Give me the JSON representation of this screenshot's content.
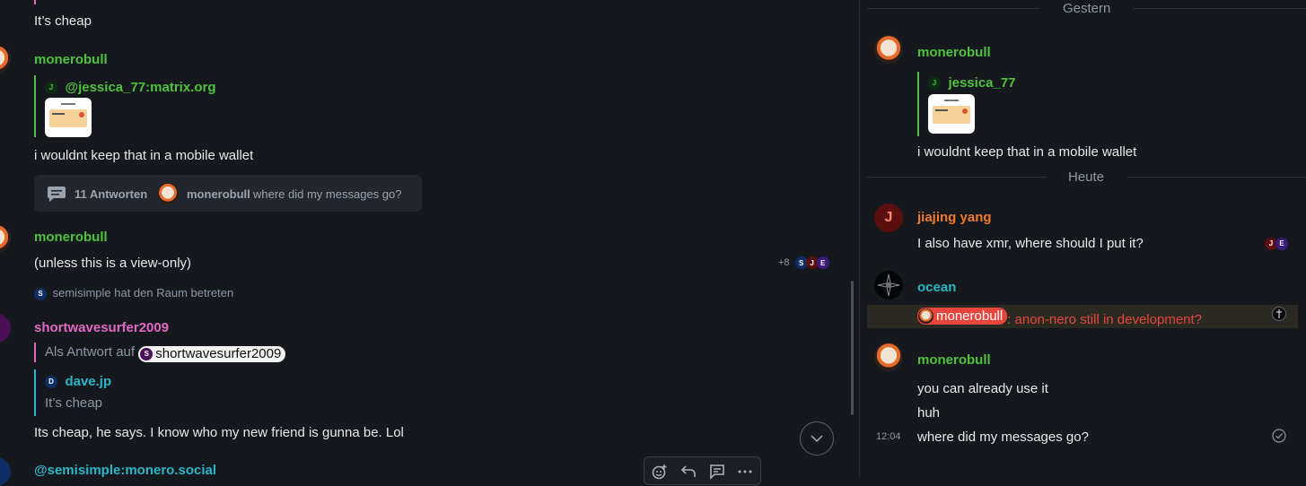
{
  "left": {
    "top_text": "It’s cheap",
    "msg1": {
      "author": "monerobull",
      "reply_user": "@jessica_77:matrix.org",
      "reply_initial": "J",
      "body": "i wouldnt keep that in a mobile wallet"
    },
    "thread": {
      "count": "11 Antworten",
      "author": "monerobull",
      "preview": "where did my messages go?"
    },
    "msg2": {
      "author": "monerobull",
      "body": "(unless this is a view-only)",
      "read_more": "+8",
      "read_initials": [
        "S",
        "J",
        "E"
      ]
    },
    "join_event": {
      "initial": "S",
      "text": "semisimple hat den Raum betreten"
    },
    "msg3": {
      "author": "shortwavesurfer2009",
      "in_reply_label": "Als Antwort auf",
      "in_reply_user": "shortwavesurfer2009",
      "in_reply_initial": "S",
      "quote_initial": "D",
      "quote_user": "dave.jp",
      "quote_text": "It’s cheap",
      "body": "Its cheap, he says. I know who my new friend is gunna be. Lol"
    },
    "msg4": {
      "author": "@semisimple:monero.social"
    },
    "action_icons": [
      "emoji-add-icon",
      "reply-icon",
      "thread-icon",
      "more-icon"
    ]
  },
  "right": {
    "sep_yesterday": "Gestern",
    "sep_today": "Heute",
    "msg1": {
      "author": "monerobull",
      "reply_initial": "J",
      "reply_user": "jessica_77",
      "body": "i wouldnt keep that in a mobile wallet"
    },
    "msg2": {
      "author": "jiajing yang",
      "avatar_initial": "J",
      "body": "I also have xmr, where should I put it?",
      "read_initials": [
        "J",
        "E"
      ]
    },
    "msg3": {
      "author": "ocean",
      "mention": "monerobull",
      "body": ": anon-nero still in development?"
    },
    "msg4": {
      "author": "monerobull",
      "lines": [
        "you can already use it",
        "huh",
        "where did my messages go?"
      ],
      "time": "12:04"
    }
  },
  "colors": {
    "background": "#15191e",
    "green_name": "#4fc13e",
    "pink_name": "#e269c3",
    "cyan_name": "#2bb5c9",
    "orange_name": "#f07a30",
    "highlight_bg": "#2a2a22",
    "mention_red": "#e8453c"
  }
}
